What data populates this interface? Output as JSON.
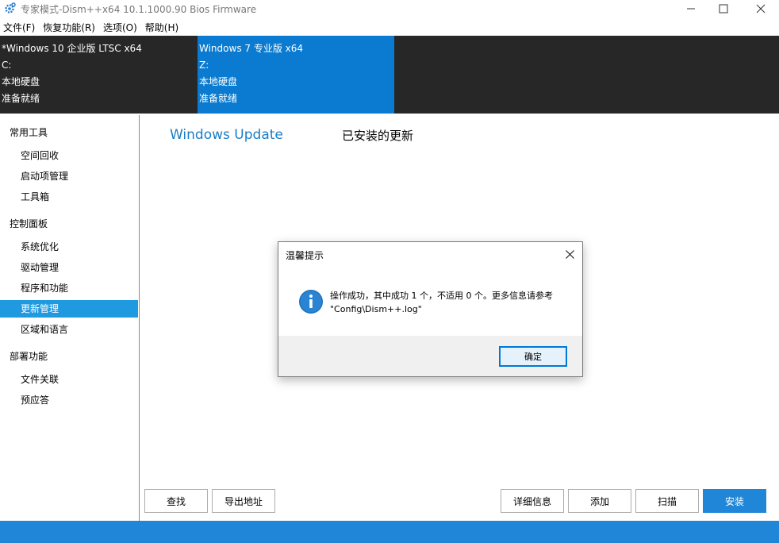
{
  "window": {
    "title": "专家模式-Dism++x64 10.1.1000.90 Bios Firmware",
    "app_icon": "gear-icon"
  },
  "menubar": {
    "items": [
      "文件(F)",
      "恢复功能(R)",
      "选项(O)",
      "帮助(H)"
    ]
  },
  "systems": [
    {
      "name": "*Windows 10 企业版 LTSC x64",
      "drive": "C:",
      "disk": "本地硬盘",
      "status": "准备就绪"
    },
    {
      "name": "Windows 7 专业版 x64",
      "drive": "Z:",
      "disk": "本地硬盘",
      "status": "准备就绪"
    }
  ],
  "sidebar": {
    "groups": [
      {
        "label": "常用工具",
        "items": [
          "空间回收",
          "启动项管理",
          "工具箱"
        ]
      },
      {
        "label": "控制面板",
        "items": [
          "系统优化",
          "驱动管理",
          "程序和功能",
          "更新管理",
          "区域和语言"
        ]
      },
      {
        "label": "部署功能",
        "items": [
          "文件关联",
          "预应答"
        ]
      }
    ],
    "selected": "更新管理"
  },
  "main": {
    "tabs": [
      "Windows Update",
      "已安装的更新"
    ],
    "buttons_left": [
      "查找",
      "导出地址"
    ],
    "buttons_right": [
      "详细信息",
      "添加",
      "扫描",
      "安装"
    ]
  },
  "dialog": {
    "title": "温馨提示",
    "message_line1": "操作成功，其中成功 1 个，不适用 0 个。更多信息请参考",
    "message_line2": "\"Config\\Dism++.log\"",
    "ok_label": "确定",
    "icon": "info-icon"
  },
  "colors": {
    "accent": "#1f86d8",
    "selected_system": "#0a7bd0",
    "system_bar": "#272727",
    "sidebar_selected": "#1f9ae0"
  }
}
